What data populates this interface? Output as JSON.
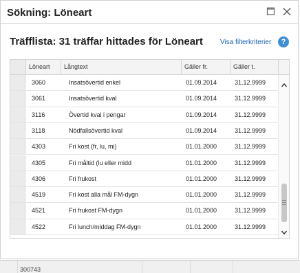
{
  "window": {
    "title": "Sökning: Löneart",
    "maximize_icon": "maximize-icon",
    "close_icon": "close-icon"
  },
  "results": {
    "heading": "Träfflista: 31 träffar hittades för Löneart",
    "filter_link": "Visa filterkriterier",
    "help_glyph": "?"
  },
  "table": {
    "columns": [
      "Löneart",
      "Långtext",
      "Gäller fr.",
      "Gäller t."
    ],
    "rows": [
      {
        "code": "3060",
        "text": "Insatsövertid enkel",
        "from": "01.09.2014",
        "to": "31.12.9999"
      },
      {
        "code": "3061",
        "text": "Insatsövertid kval",
        "from": "01.09.2014",
        "to": "31.12.9999"
      },
      {
        "code": "3116",
        "text": "Övertid kval i pengar",
        "from": "01.09.2014",
        "to": "31.12.9999"
      },
      {
        "code": "3118",
        "text": "Nödfallsövertid kval",
        "from": "01.09.2014",
        "to": "31.12.9999"
      },
      {
        "code": "4303",
        "text": "Fri kost (fr, lu, mi)",
        "from": "01.01.2000",
        "to": "31.12.9999"
      },
      {
        "code": "4305",
        "text": "Fri måltid (lu eller midd",
        "from": "01.01.2000",
        "to": "31.12.9999"
      },
      {
        "code": "4306",
        "text": "Fri frukost",
        "from": "01.01.2000",
        "to": "31.12.9999"
      },
      {
        "code": "4519",
        "text": "Fri kost alla mål FM-dygn",
        "from": "01.01.2000",
        "to": "31.12.9999"
      },
      {
        "code": "4521",
        "text": "Fri frukost FM-dygn",
        "from": "01.01.2000",
        "to": "31.12.9999"
      },
      {
        "code": "4522",
        "text": "Fri lunch/middag FM-dygn",
        "from": "01.01.2000",
        "to": "31.12.9999"
      }
    ]
  },
  "background": {
    "partial_text": "300743"
  }
}
